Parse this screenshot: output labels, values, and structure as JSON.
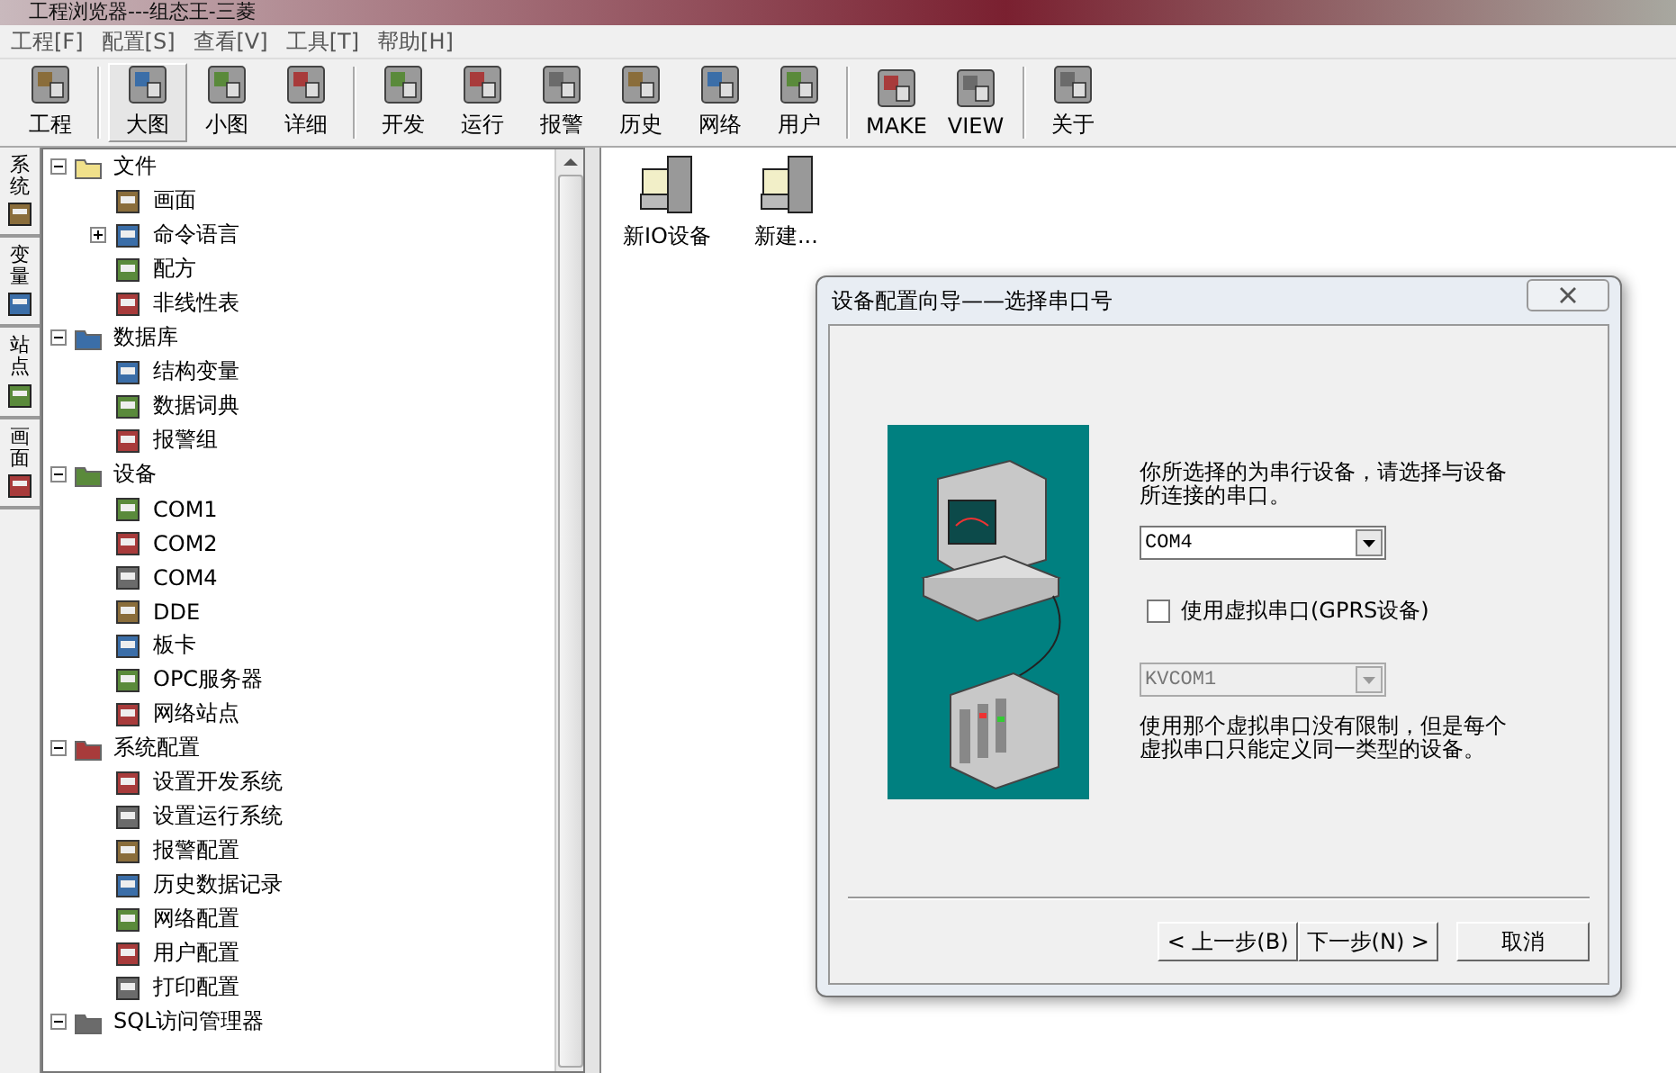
{
  "window": {
    "title": "工程浏览器---组态王-三菱"
  },
  "menu": [
    "工程[F]",
    "配置[S]",
    "查看[V]",
    "工具[T]",
    "帮助[H]"
  ],
  "toolbar": [
    [
      {
        "label": "工程",
        "selected": false
      }
    ],
    [
      {
        "label": "大图",
        "selected": true
      },
      {
        "label": "小图",
        "selected": false
      },
      {
        "label": "详细",
        "selected": false
      }
    ],
    [
      {
        "label": "开发",
        "selected": false
      },
      {
        "label": "运行",
        "selected": false
      },
      {
        "label": "报警",
        "selected": false
      },
      {
        "label": "历史",
        "selected": false
      },
      {
        "label": "网络",
        "selected": false
      },
      {
        "label": "用户",
        "selected": false
      }
    ],
    [
      {
        "label": "MAKE",
        "selected": false
      },
      {
        "label": "VIEW",
        "selected": false
      }
    ],
    [
      {
        "label": "关于",
        "selected": false
      }
    ]
  ],
  "side_tabs": [
    "系统",
    "变量",
    "站点",
    "画面"
  ],
  "tree": [
    {
      "label": "文件",
      "expanded": true,
      "children": [
        {
          "label": "画面"
        },
        {
          "label": "命令语言",
          "expanded": false
        },
        {
          "label": "配方"
        },
        {
          "label": "非线性表"
        }
      ]
    },
    {
      "label": "数据库",
      "expanded": true,
      "children": [
        {
          "label": "结构变量"
        },
        {
          "label": "数据词典"
        },
        {
          "label": "报警组"
        }
      ]
    },
    {
      "label": "设备",
      "expanded": true,
      "children": [
        {
          "label": "COM1"
        },
        {
          "label": "COM2"
        },
        {
          "label": "COM4"
        },
        {
          "label": "DDE"
        },
        {
          "label": "板卡"
        },
        {
          "label": "OPC服务器"
        },
        {
          "label": "网络站点"
        }
      ]
    },
    {
      "label": "系统配置",
      "expanded": true,
      "children": [
        {
          "label": "设置开发系统"
        },
        {
          "label": "设置运行系统"
        },
        {
          "label": "报警配置"
        },
        {
          "label": "历史数据记录"
        },
        {
          "label": "网络配置"
        },
        {
          "label": "用户配置"
        },
        {
          "label": "打印配置"
        }
      ]
    },
    {
      "label": "SQL访问管理器",
      "expanded": true
    }
  ],
  "content_items": [
    "新IO设备",
    "新建..."
  ],
  "dialog": {
    "title": "设备配置向导——选择串口号",
    "intro": "你所选择的为串行设备，请选择与设备所连接的串口。",
    "port_select": {
      "value": "COM4",
      "disabled": false
    },
    "virtual_checkbox": {
      "label": "使用虚拟串口(GPRS设备)",
      "checked": false
    },
    "virtual_select": {
      "value": "KVCOM1",
      "disabled": true
    },
    "note": "使用那个虚拟串口没有限制，但是每个虚拟串口只能定义同一类型的设备。",
    "buttons": [
      "< 上一步(B)",
      "下一步(N) >",
      "取消"
    ]
  }
}
